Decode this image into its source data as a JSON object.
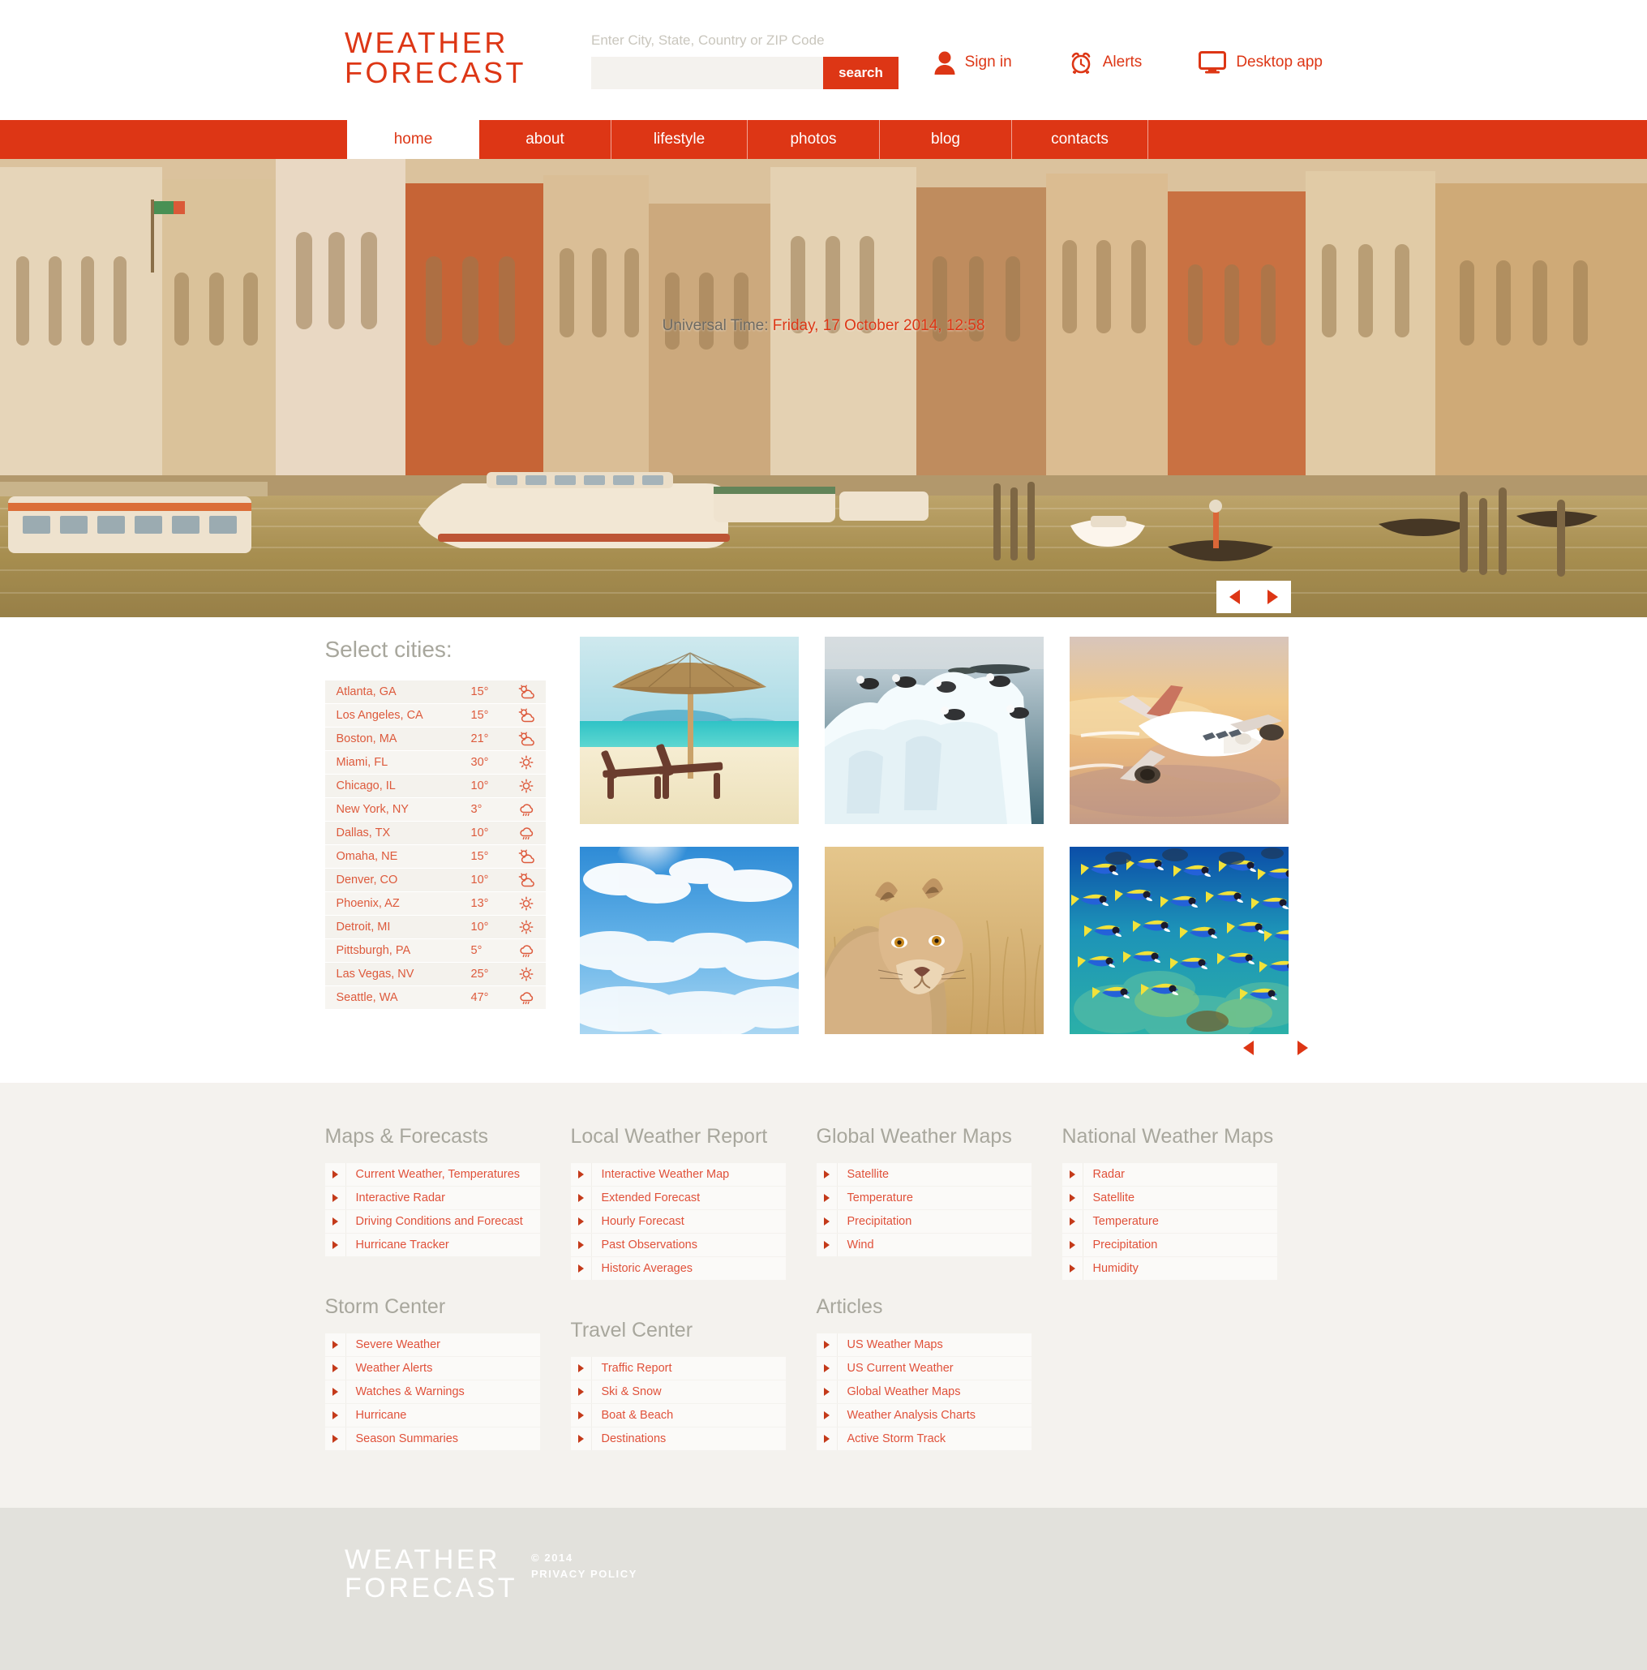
{
  "brand": {
    "line1": "WEATHER",
    "line2": "FORECAST"
  },
  "search": {
    "label": "Enter City, State, Country or ZIP Code",
    "value": "",
    "placeholder": "",
    "button_label": "search"
  },
  "header_links": [
    {
      "label": "Sign in",
      "icon": "user-icon"
    },
    {
      "label": "Alerts",
      "icon": "alarm-clock-icon"
    },
    {
      "label": "Desktop app",
      "icon": "monitor-icon"
    }
  ],
  "nav": {
    "items": [
      {
        "label": "home",
        "active": true
      },
      {
        "label": "about",
        "active": false
      },
      {
        "label": "lifestyle",
        "active": false
      },
      {
        "label": "photos",
        "active": false
      },
      {
        "label": "blog",
        "active": false
      },
      {
        "label": "contacts",
        "active": false
      }
    ]
  },
  "hero": {
    "time_label": "Universal Time:",
    "time_value": "Friday, 17 October 2014, 12:58",
    "prev_label": "prev-slide",
    "next_label": "next-slide"
  },
  "cities": {
    "title": "Select cities:",
    "items": [
      {
        "name": "Atlanta, GA",
        "temp": "15°",
        "icon": "partly-cloudy-icon"
      },
      {
        "name": "Los Angeles, CA",
        "temp": "15°",
        "icon": "partly-cloudy-icon"
      },
      {
        "name": "Boston, MA",
        "temp": "21°",
        "icon": "partly-cloudy-icon"
      },
      {
        "name": "Miami, FL",
        "temp": "30°",
        "icon": "sun-icon"
      },
      {
        "name": "Chicago, IL",
        "temp": "10°",
        "icon": "sun-icon"
      },
      {
        "name": "New York, NY",
        "temp": "3°",
        "icon": "rain-cloud-icon"
      },
      {
        "name": "Dallas, TX",
        "temp": "10°",
        "icon": "rain-cloud-icon"
      },
      {
        "name": "Omaha, NE",
        "temp": "15°",
        "icon": "partly-cloudy-icon"
      },
      {
        "name": "Denver, CO",
        "temp": "10°",
        "icon": "partly-cloudy-icon"
      },
      {
        "name": "Phoenix, AZ",
        "temp": "13°",
        "icon": "sun-icon"
      },
      {
        "name": "Detroit, MI",
        "temp": "10°",
        "icon": "sun-icon"
      },
      {
        "name": "Pittsburgh, PA",
        "temp": "5°",
        "icon": "rain-cloud-icon"
      },
      {
        "name": "Las Vegas, NV",
        "temp": "25°",
        "icon": "sun-icon"
      },
      {
        "name": "Seattle, WA",
        "temp": "47°",
        "icon": "rain-cloud-icon"
      }
    ]
  },
  "gallery": {
    "items": [
      {
        "name": "beach-umbrella-loungers"
      },
      {
        "name": "seagulls-on-iceberg"
      },
      {
        "name": "airplane-at-sunset"
      },
      {
        "name": "blue-sky-clouds"
      },
      {
        "name": "lioness-in-grass"
      },
      {
        "name": "school-of-blue-fish"
      }
    ],
    "prev_label": "prev-gallery",
    "next_label": "next-gallery"
  },
  "link_sections": [
    {
      "title": "Maps & Forecasts",
      "items": [
        "Current Weather, Temperatures",
        "Interactive Radar",
        "Driving Conditions and Forecast",
        "Hurricane Tracker"
      ]
    },
    {
      "title": "Storm Center",
      "items": [
        "Severe Weather",
        "Weather Alerts",
        "Watches & Warnings",
        "Hurricane",
        "Season Summaries"
      ]
    },
    {
      "title": "Local Weather Report",
      "items": [
        "Interactive Weather Map",
        "Extended Forecast",
        "Hourly Forecast",
        "Past Observations",
        "Historic Averages"
      ]
    },
    {
      "title": "Travel Center",
      "items": [
        "Traffic Report",
        "Ski & Snow",
        "Boat & Beach",
        "Destinations"
      ]
    },
    {
      "title": "Global Weather Maps",
      "items": [
        "Satellite",
        "Temperature",
        "Precipitation",
        "Wind"
      ]
    },
    {
      "title": "Articles",
      "items": [
        "US Weather Maps",
        "US Current Weather",
        "Global Weather Maps",
        "Weather Analysis Charts",
        "Active Storm Track"
      ]
    },
    {
      "title": "National Weather Maps",
      "items": [
        "Radar",
        "Satellite",
        "Temperature",
        "Precipitation",
        "Humidity"
      ]
    }
  ],
  "footer": {
    "brand_line1": "WEATHER",
    "brand_line2": "FORECAST",
    "copyright": "© 2014",
    "privacy": "PRIVACY POLICY"
  },
  "colors": {
    "accent": "#dd3615",
    "accent_light": "#e0513a",
    "muted": "#a8a79d",
    "panel": "#f4f2ee",
    "row": "#f7f5f1",
    "footer_bg": "#e2e1dc"
  }
}
